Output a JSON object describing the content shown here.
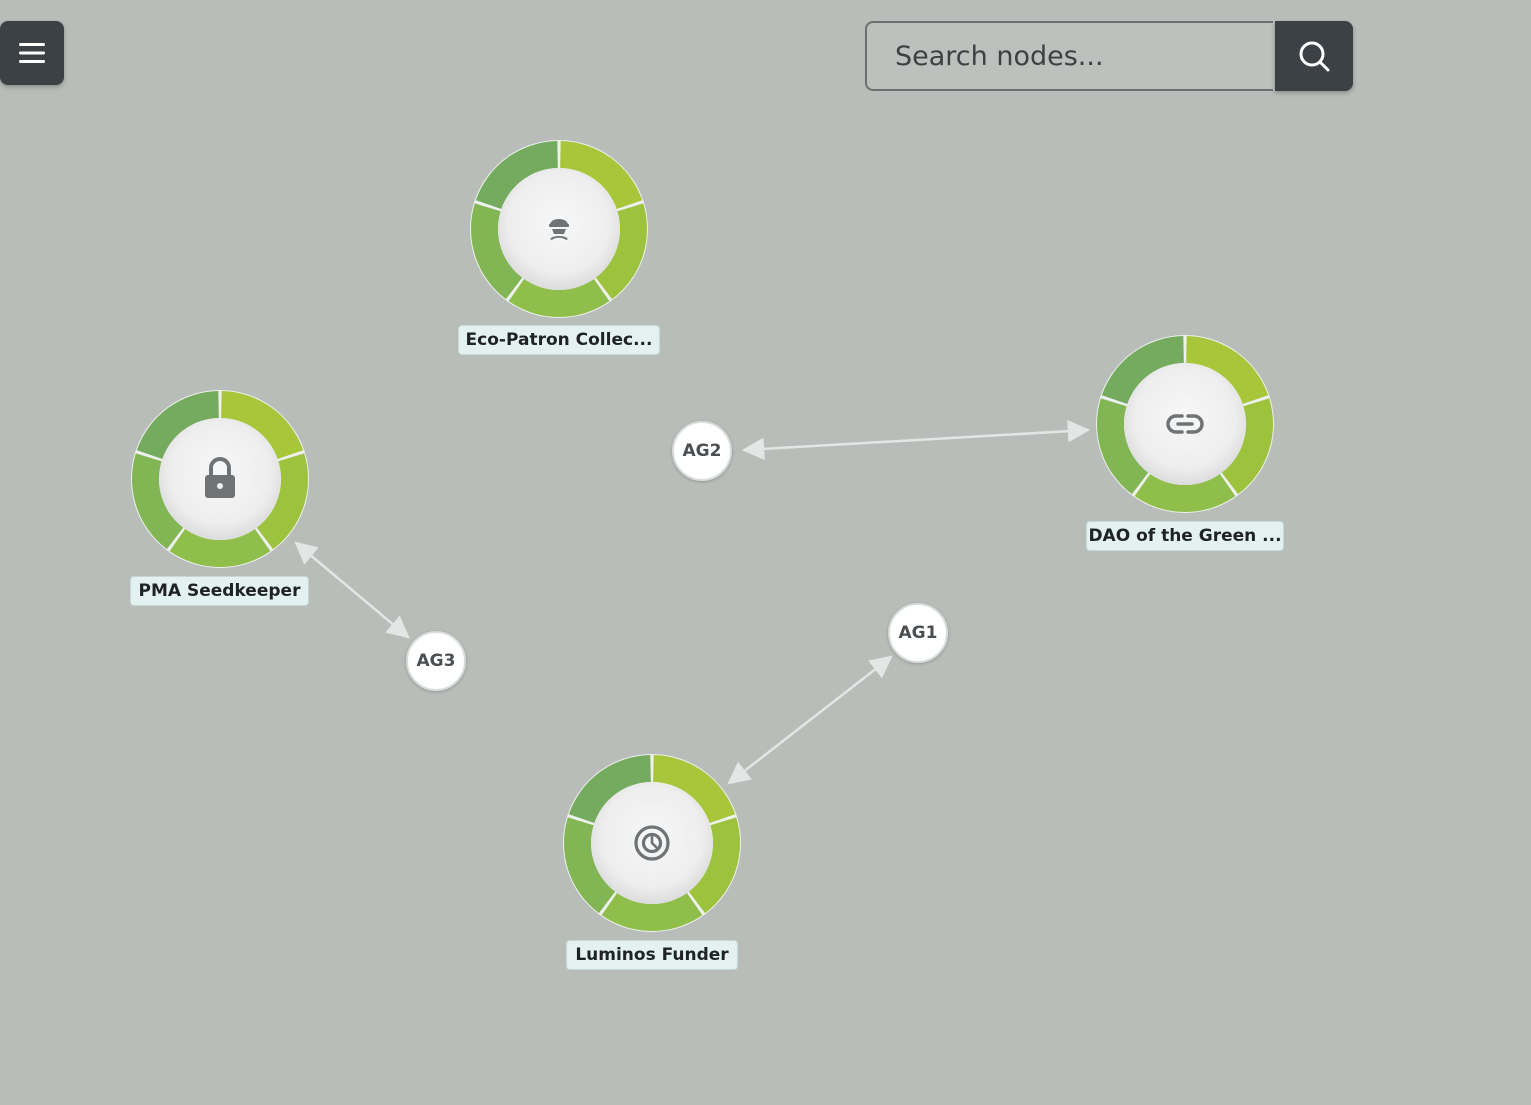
{
  "toolbar": {
    "menu_icon": "hamburger-menu-icon",
    "search_placeholder": "Search nodes...",
    "search_icon": "search-icon"
  },
  "colors": {
    "background": "#b8bdb9",
    "ring_segment_1": "#a8c63a",
    "ring_segment_2": "#9dc23d",
    "ring_segment_3": "#8fbe4a",
    "ring_segment_4": "#82b553",
    "ring_segment_5": "#74ab5f",
    "edge": "#e4e6e5"
  },
  "nodes": [
    {
      "id": "eco",
      "label": "Eco-Patron Collec...",
      "icon": "person-incognito-icon"
    },
    {
      "id": "pma",
      "label": "PMA Seedkeeper",
      "icon": "lock-icon"
    },
    {
      "id": "dao",
      "label": "DAO of the Green ...",
      "icon": "link-icon"
    },
    {
      "id": "luminos",
      "label": "Luminos Funder",
      "icon": "pie-chart-icon"
    }
  ],
  "agents": [
    {
      "id": "ag2",
      "label": "AG2"
    },
    {
      "id": "ag3",
      "label": "AG3"
    },
    {
      "id": "ag1",
      "label": "AG1"
    }
  ],
  "edges": [
    {
      "from": "ag2",
      "to": "dao"
    },
    {
      "from": "pma",
      "to": "ag3"
    },
    {
      "from": "luminos",
      "to": "ag1"
    }
  ]
}
